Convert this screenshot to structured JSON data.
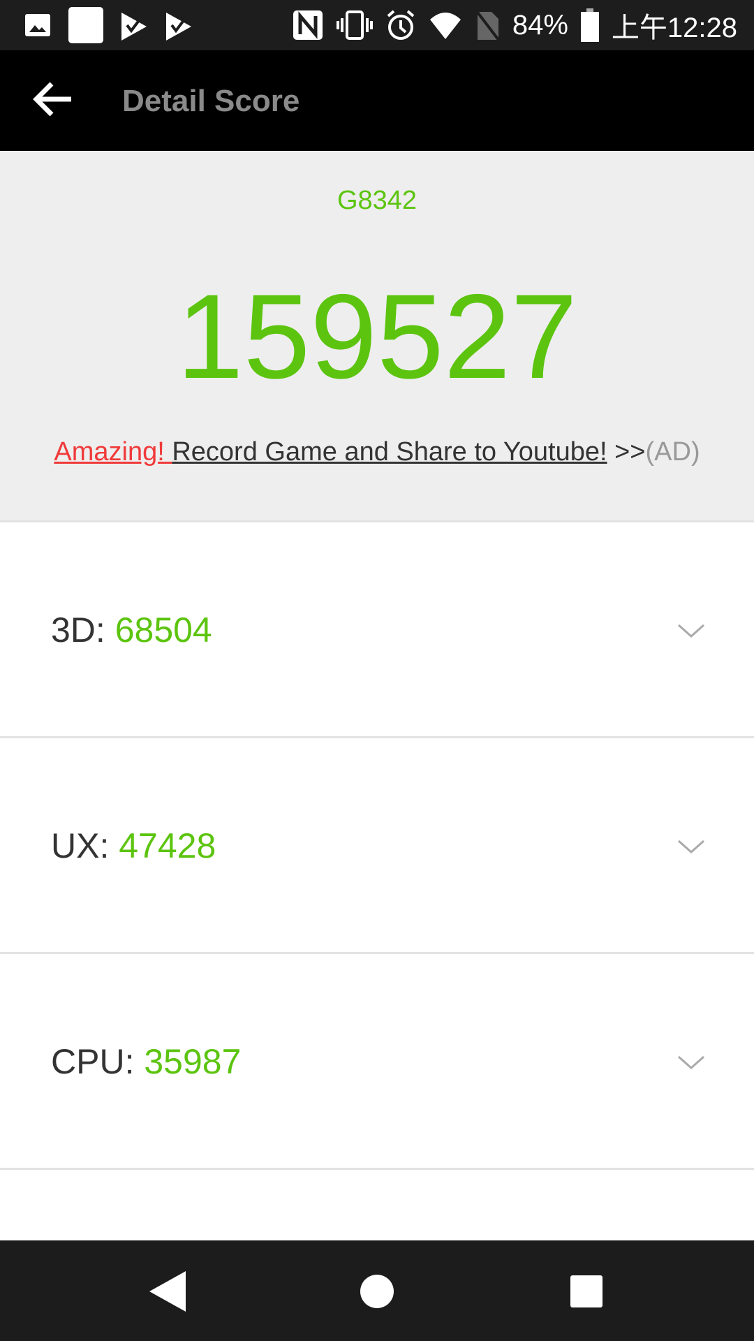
{
  "status_bar": {
    "battery": "84%",
    "time": "上午12:28",
    "icons": [
      "image-icon",
      "blank-notification-icon",
      "check-app-icon",
      "check-app-icon",
      "nfc-icon",
      "vibrate-icon",
      "alarm-icon",
      "wifi-icon",
      "no-sim-icon",
      "battery-icon"
    ]
  },
  "app_bar": {
    "title": "Detail Score"
  },
  "summary": {
    "device": "G8342",
    "total_score": "159527",
    "ad_highlight": "Amazing! ",
    "ad_text": "Record Game and Share to Youtube!",
    "ad_arrows": " >>",
    "ad_tag": "(AD)"
  },
  "scores": [
    {
      "label": "3D: ",
      "value": "68504"
    },
    {
      "label": "UX: ",
      "value": "47428"
    },
    {
      "label": "CPU: ",
      "value": "35987"
    }
  ],
  "colors": {
    "accent": "#5cc40f",
    "ad_red": "#f03a3a"
  }
}
